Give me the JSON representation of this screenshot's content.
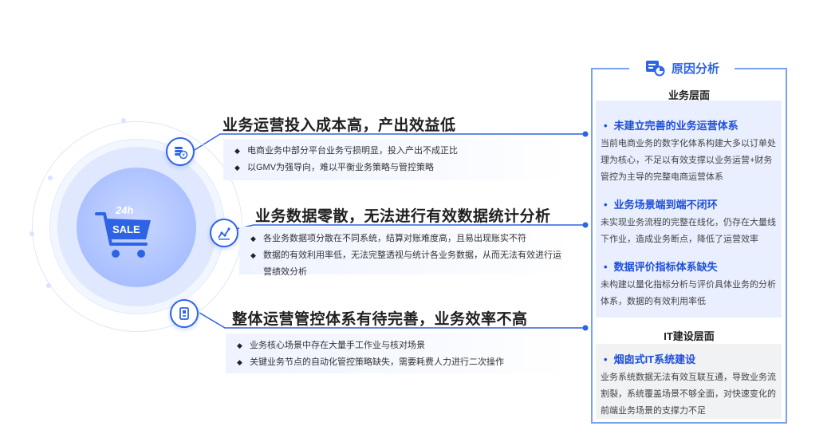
{
  "center_badge": {
    "top_text": "24h",
    "bottom_text": "SALE"
  },
  "sections": [
    {
      "title": "业务运营投入成本高，产出效益低",
      "icon": "coin-stack-icon",
      "bullets": [
        "电商业务中部分平台业务亏损明显，投入产出不成正比",
        "以GMV为强导向，难以平衡业务策略与管控策略"
      ]
    },
    {
      "title": "业务数据零散，无法进行有效数据统计分析",
      "icon": "data-chart-icon",
      "bullets": [
        "各业务数据项分散在不同系统，结算对账难度高，且易出现账实不符",
        "数据的有效利用率低，无法完整透视与统计各业务数据，从而无法有效进行运营绩效分析"
      ]
    },
    {
      "title": "整体运营管控体系有待完善，业务效率不高",
      "icon": "document-check-icon",
      "bullets": [
        "业务核心场景中存在大量手工作业与核对场景",
        "关键业务节点的自动化管控策略缺失，需要耗费人力进行二次操作"
      ]
    }
  ],
  "right_panel": {
    "title": "原因分析",
    "icon": "analysis-icon",
    "colors": {
      "accent": "#2e63e6",
      "border": "#7aa0f2",
      "card_blue": "#e9efff",
      "card_gray": "#f1f2f4"
    },
    "business_layer": {
      "title": "业务层面",
      "reasons": [
        {
          "head": "未建立完善的业务运营体系",
          "desc": "当前电商业务的数字化体系构建大多以订单处理为核心，不足以有效支撑以业务运营+财务管控为主导的完整电商运营体系"
        },
        {
          "head": "业务场景端到端不闭环",
          "desc": "未实现业务流程的完整在线化，仍存在大量线下作业，造成业务断点，降低了运营效率"
        },
        {
          "head": "数据评价指标体系缺失",
          "desc": "未构建以量化指标分析与评价具体业务的分析体系，数据的有效利用率低"
        }
      ]
    },
    "it_layer": {
      "title": "IT建设层面",
      "reasons": [
        {
          "head": "烟囱式IT系统建设",
          "desc": "业务系统数据无法有效互联互通，导致业务流割裂，系统覆盖场景不够全面，对快速变化的前端业务场景的支撑力不足"
        }
      ]
    }
  },
  "bullet_marker": "◆",
  "reason_marker": "•"
}
